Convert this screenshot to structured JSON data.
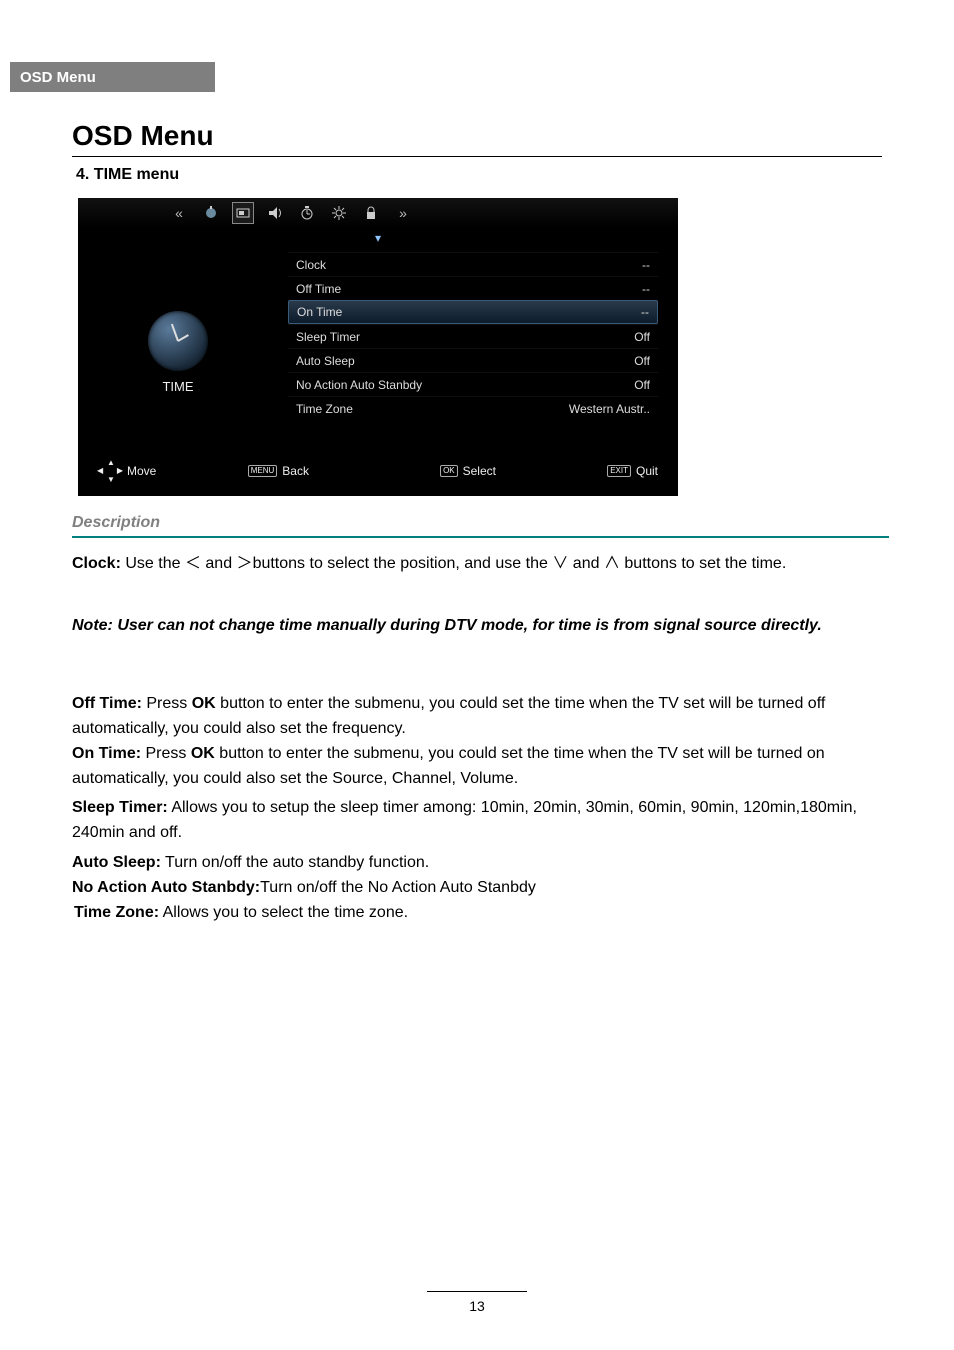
{
  "header_tab": "OSD Menu",
  "page_title": "OSD Menu",
  "subtitle": "4. TIME menu",
  "osd": {
    "side_label": "TIME",
    "rows": [
      {
        "label": "Clock",
        "value": "--",
        "selected": false
      },
      {
        "label": "Off Time",
        "value": "--",
        "selected": false
      },
      {
        "label": "On Time",
        "value": "--",
        "selected": true
      },
      {
        "label": "Sleep Timer",
        "value": "Off",
        "selected": false
      },
      {
        "label": "Auto Sleep",
        "value": "Off",
        "selected": false
      },
      {
        "label": "No Action Auto Stanbdy",
        "value": "Off",
        "selected": false
      },
      {
        "label": "Time Zone",
        "value": "Western Austr..",
        "selected": false
      }
    ],
    "hints": {
      "move": "Move",
      "back_key": "MENU",
      "back": "Back",
      "select_key": "OK",
      "select": "Select",
      "quit_key": "EXIT",
      "quit": "Quit"
    }
  },
  "desc_heading": "Description",
  "clock_b": "Clock:",
  "clock_1": " Use the ",
  "clock_lt": "＜",
  "clock_2": " and ",
  "clock_gt": "＞",
  "clock_3": "buttons to select the position, and use the ",
  "clock_down": "∨",
  "clock_4": " and ",
  "clock_up": "∧",
  "clock_5": " buttons to set the time.",
  "note": "Note: User can not change time manually during DTV mode, for time is from signal source directly.",
  "off_b": "Off Time:",
  "off_t1": " Press ",
  "off_ok": "OK",
  "off_t2": " button to enter the submenu, you could set the time when the TV set will be turned off automatically, you could also set the frequency.",
  "on_b": "On Time:",
  "on_t1": " Press ",
  "on_ok": "OK",
  "on_t2": " button to enter the submenu, you could set the time when the TV set will be turned on automatically, you could also set the Source, Channel, Volume.",
  "sleep_b": "Sleep Timer:",
  "sleep_t": " Allows you to setup the sleep timer among: 10min, 20min, 30min, 60min, 90min, 120min,180min, 240min and off.",
  "auto_b": "Auto Sleep:",
  "auto_t": " Turn on/off the auto standby function.",
  "noact_b": "No Action Auto Stanbdy:",
  "noact_t": "Turn on/off the No Action Auto Stanbdy",
  "tz_b": "Time Zone:",
  "tz_t": " Allows you to select the time zone.",
  "page_number": "13"
}
